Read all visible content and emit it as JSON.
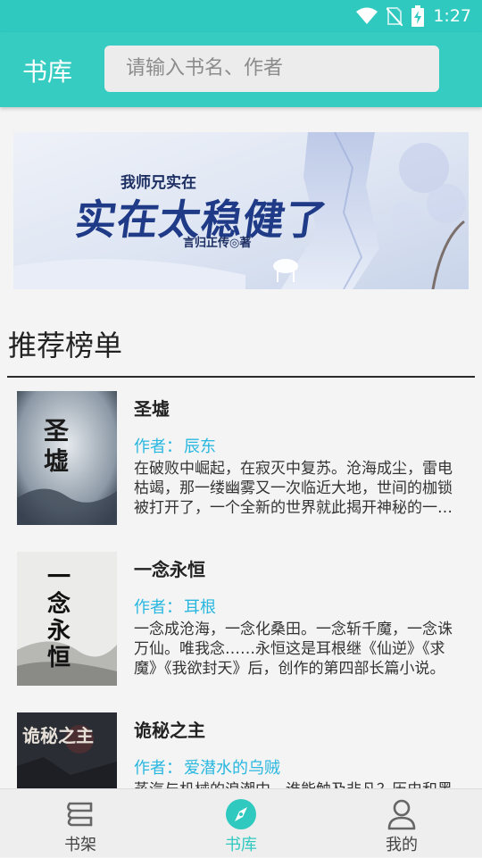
{
  "status_bar": {
    "time": "1:27",
    "icons": [
      "wifi-icon",
      "no-sim-icon",
      "battery-charging-icon"
    ]
  },
  "app_bar": {
    "title": "书库",
    "search_placeholder": "请输入书名、作者"
  },
  "banner": {
    "small_title": "我师兄实在",
    "main_title": "实在太稳健了",
    "author_credit": "言归正传◎著"
  },
  "section": {
    "title": "推荐榜单"
  },
  "books": [
    {
      "title": "圣墟",
      "author_label": "作者：",
      "author": "辰东",
      "description": "在破败中崛起，在寂灭中复苏。沧海成尘，雷电枯竭，那一缕幽雾又一次临近大地，世间的枷锁被打开了，一个全新的世界就此揭开神秘的一角……",
      "cover_text": "圣墟"
    },
    {
      "title": "一念永恒",
      "author_label": "作者：",
      "author": "耳根",
      "description": "一念成沧海，一念化桑田。一念斩千魔，一念诛万仙。唯我念……永恒这是耳根继《仙逆》《求魔》《我欲封天》后，创作的第四部长篇小说。",
      "cover_text": "一念永恒"
    },
    {
      "title": "诡秘之主",
      "author_label": "作者：",
      "author": "爱潜水的乌贼",
      "description": "蒸汽与机械的浪潮中，谁能触及非凡？历史和黑暗的迷雾里，又是谁在耳语？",
      "cover_text": "诡秘之主"
    }
  ],
  "bottom_nav": [
    {
      "label": "书架",
      "icon": "bookshelf-icon",
      "active": false
    },
    {
      "label": "书库",
      "icon": "compass-icon",
      "active": true
    },
    {
      "label": "我的",
      "icon": "person-icon",
      "active": false
    }
  ],
  "colors": {
    "accent": "#37ccc2",
    "author_link": "#29b7e0",
    "background": "#f4f4f4"
  }
}
